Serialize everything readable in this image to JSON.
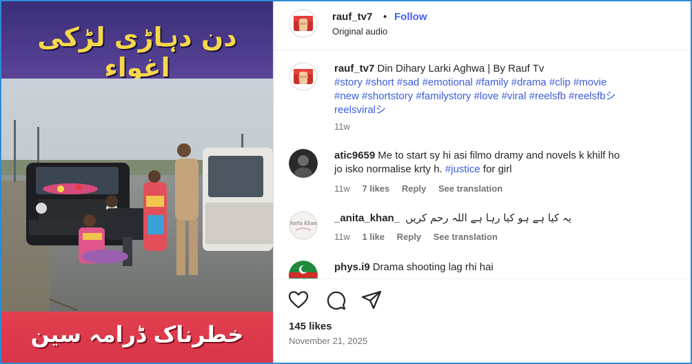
{
  "video": {
    "title_urdu": "دن دہاڑی لڑکی اغواء",
    "caption_urdu": "خطرناک ڈرامہ سین"
  },
  "header": {
    "username": "rauf_tv7",
    "dot": "•",
    "follow_label": "Follow",
    "audio": "Original audio"
  },
  "post": {
    "username": "rauf_tv7",
    "caption": "Din Dihary Larki Aghwa | By Rauf Tv",
    "hashtags_line1": "#story #short #sad #emotional #family #drama #clip #movie",
    "hashtags_line2": "#new #shortstory #familystory #love #viral #reelsfb #reelsfbシ",
    "hashtags_line3": "reelsviralシ",
    "time": "11w"
  },
  "comments": [
    {
      "username": "atic9659",
      "text_line1": "Me to start sy hi asi filmo dramy and novels k khilf ho",
      "text_line2a": "jo isko normalise krty h. ",
      "hashtag": "#justice",
      "text_line2b": " for girl",
      "time": "11w",
      "likes": "7 likes",
      "reply": "Reply",
      "translate": "See translation"
    },
    {
      "username": "_anita_khan_",
      "text": "یہ کیا ہے ہو کیا رہا ہے اللہ رحم کریں",
      "time": "11w",
      "likes": "1 like",
      "reply": "Reply",
      "translate": "See translation",
      "avatar_text": "Anita Khan"
    },
    {
      "username": "phys.i9",
      "text": "Drama shooting lag rhi hai"
    }
  ],
  "actions": {
    "likes": "145 likes",
    "date": "November 21, 2025"
  },
  "icons": [
    "heart-icon",
    "comment-icon",
    "share-icon"
  ]
}
